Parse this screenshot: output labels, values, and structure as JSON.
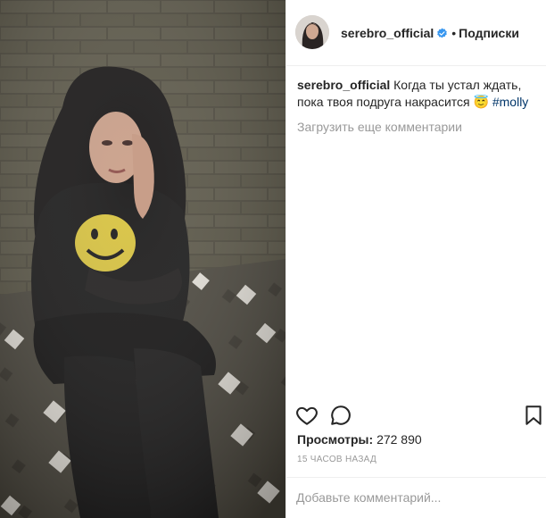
{
  "post": {
    "media": {
      "description_icon": "video-frame",
      "shirt_emblem": "smiley-face"
    },
    "header": {
      "username": "serebro_official",
      "verified": true,
      "separator": "•",
      "follow_label": "Подписки"
    },
    "caption": {
      "username": "serebro_official",
      "text": "Когда ты устал ждать, пока твоя подруга накрасится 😇",
      "hashtag": "#molly"
    },
    "load_more_label": "Загрузить еще комментарии",
    "actions": {
      "like_icon": "heart-outline-icon",
      "comment_icon": "speech-bubble-icon",
      "save_icon": "bookmark-icon"
    },
    "views": {
      "label": "Просмотры:",
      "count": "272 890"
    },
    "timestamp": "15 ЧАСОВ НАЗАД",
    "comment_input": {
      "placeholder": "Добавьте комментарий..."
    },
    "colors": {
      "accent_link": "#003569",
      "verified_blue": "#3897f0",
      "muted_text": "#999999"
    }
  }
}
